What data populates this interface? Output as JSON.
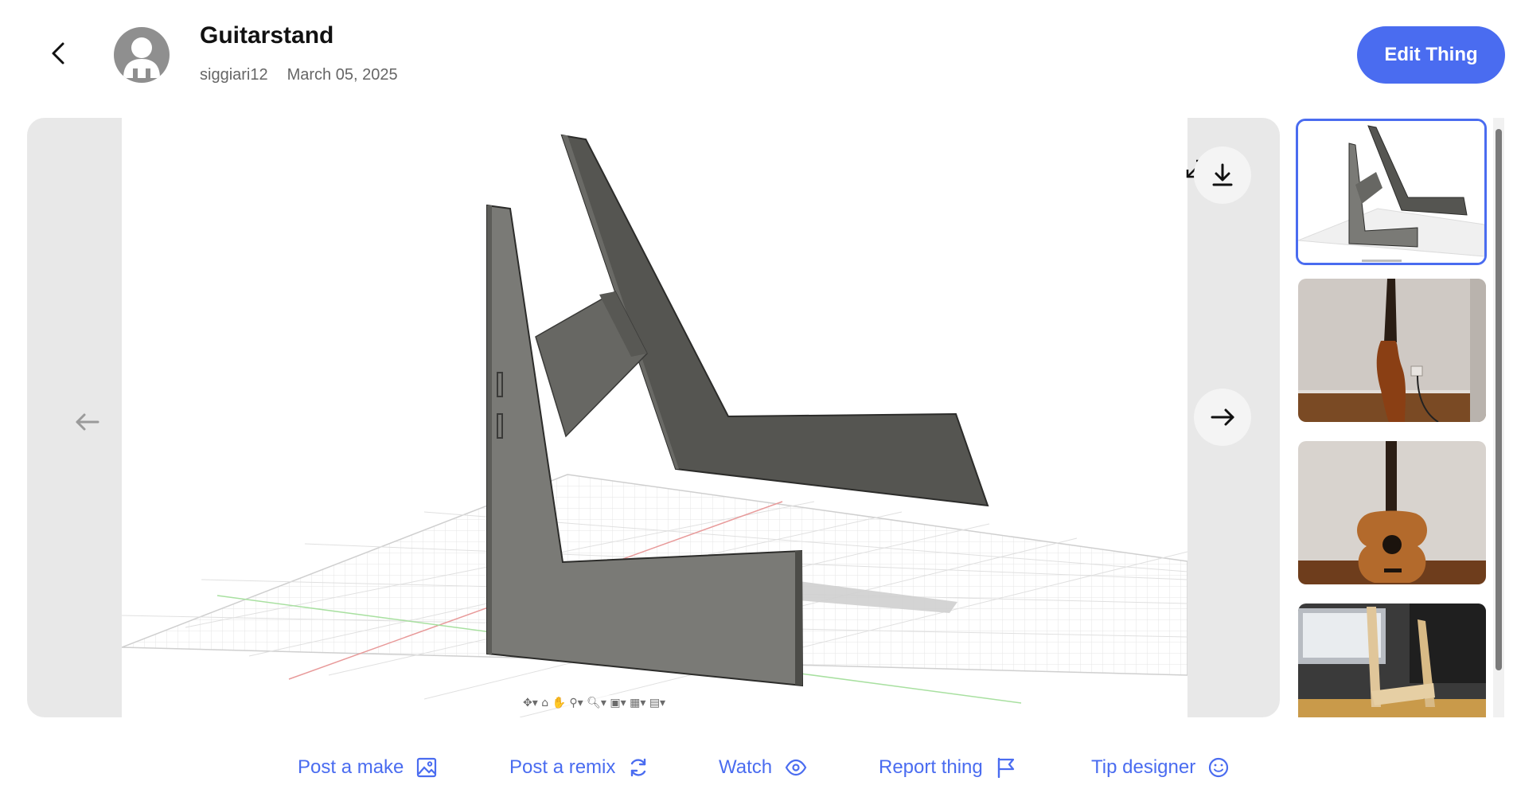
{
  "header": {
    "title": "Guitarstand",
    "author": "siggiari12",
    "date": "March 05, 2025",
    "edit_label": "Edit Thing"
  },
  "viewer": {
    "icons": {
      "prev": "arrow-left-icon",
      "next": "arrow-right-icon",
      "download": "download-icon",
      "expand": "expand-icon"
    }
  },
  "thumbnails": [
    {
      "name": "3d-model-render",
      "active": true
    },
    {
      "name": "guitar-side-photo",
      "active": false
    },
    {
      "name": "guitar-front-photo",
      "active": false
    },
    {
      "name": "stand-desk-photo",
      "active": false
    }
  ],
  "actions": [
    {
      "label": "Post a make",
      "icon": "image-icon"
    },
    {
      "label": "Post a remix",
      "icon": "refresh-icon"
    },
    {
      "label": "Watch",
      "icon": "eye-icon"
    },
    {
      "label": "Report thing",
      "icon": "flag-icon"
    },
    {
      "label": "Tip designer",
      "icon": "smiley-icon"
    }
  ],
  "colors": {
    "accent": "#4a6cf0",
    "model_dark": "#555551",
    "model_light": "#7b7b77"
  }
}
